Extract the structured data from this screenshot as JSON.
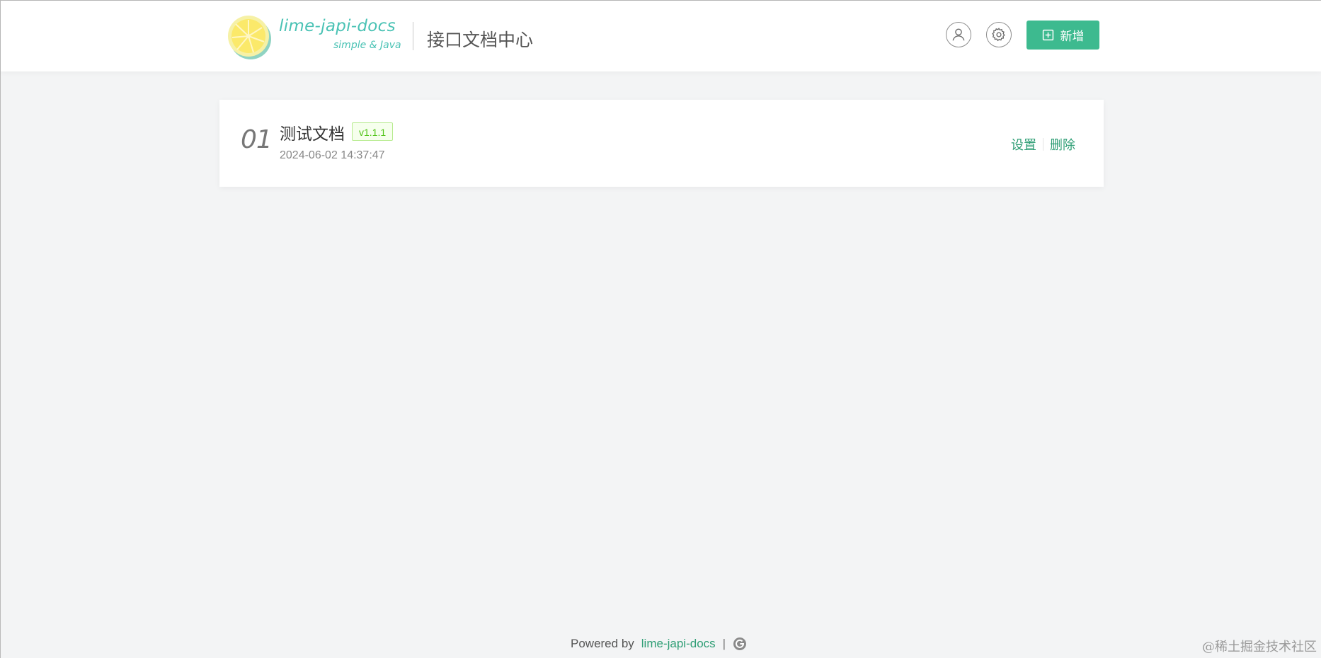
{
  "header": {
    "brand_name": "lime-japi-docs",
    "brand_tagline": "simple & Java",
    "title": "接口文档中心",
    "user_icon": "user-icon",
    "settings_icon": "gear-icon",
    "add_button_label": "新增",
    "add_button_icon": "plus-square-icon"
  },
  "docs": [
    {
      "index": "01",
      "title": "测试文档",
      "version": "v1.1.1",
      "time": "2024-06-02 14:37:47",
      "actions": [
        "设置",
        "删除"
      ]
    }
  ],
  "footer": {
    "powered_by": "Powered by",
    "link_text": "lime-japi-docs",
    "separator": "|",
    "icon": "github-g-icon"
  },
  "watermark": "@稀土掘金技术社区",
  "colors": {
    "accent": "#3dba8f",
    "link": "#2f9e75",
    "brand": "#49c2b4",
    "badge_border": "#b7eb8f",
    "badge_bg": "#f6ffed",
    "badge_text": "#52c41a",
    "page_bg": "#f3f4f5"
  }
}
